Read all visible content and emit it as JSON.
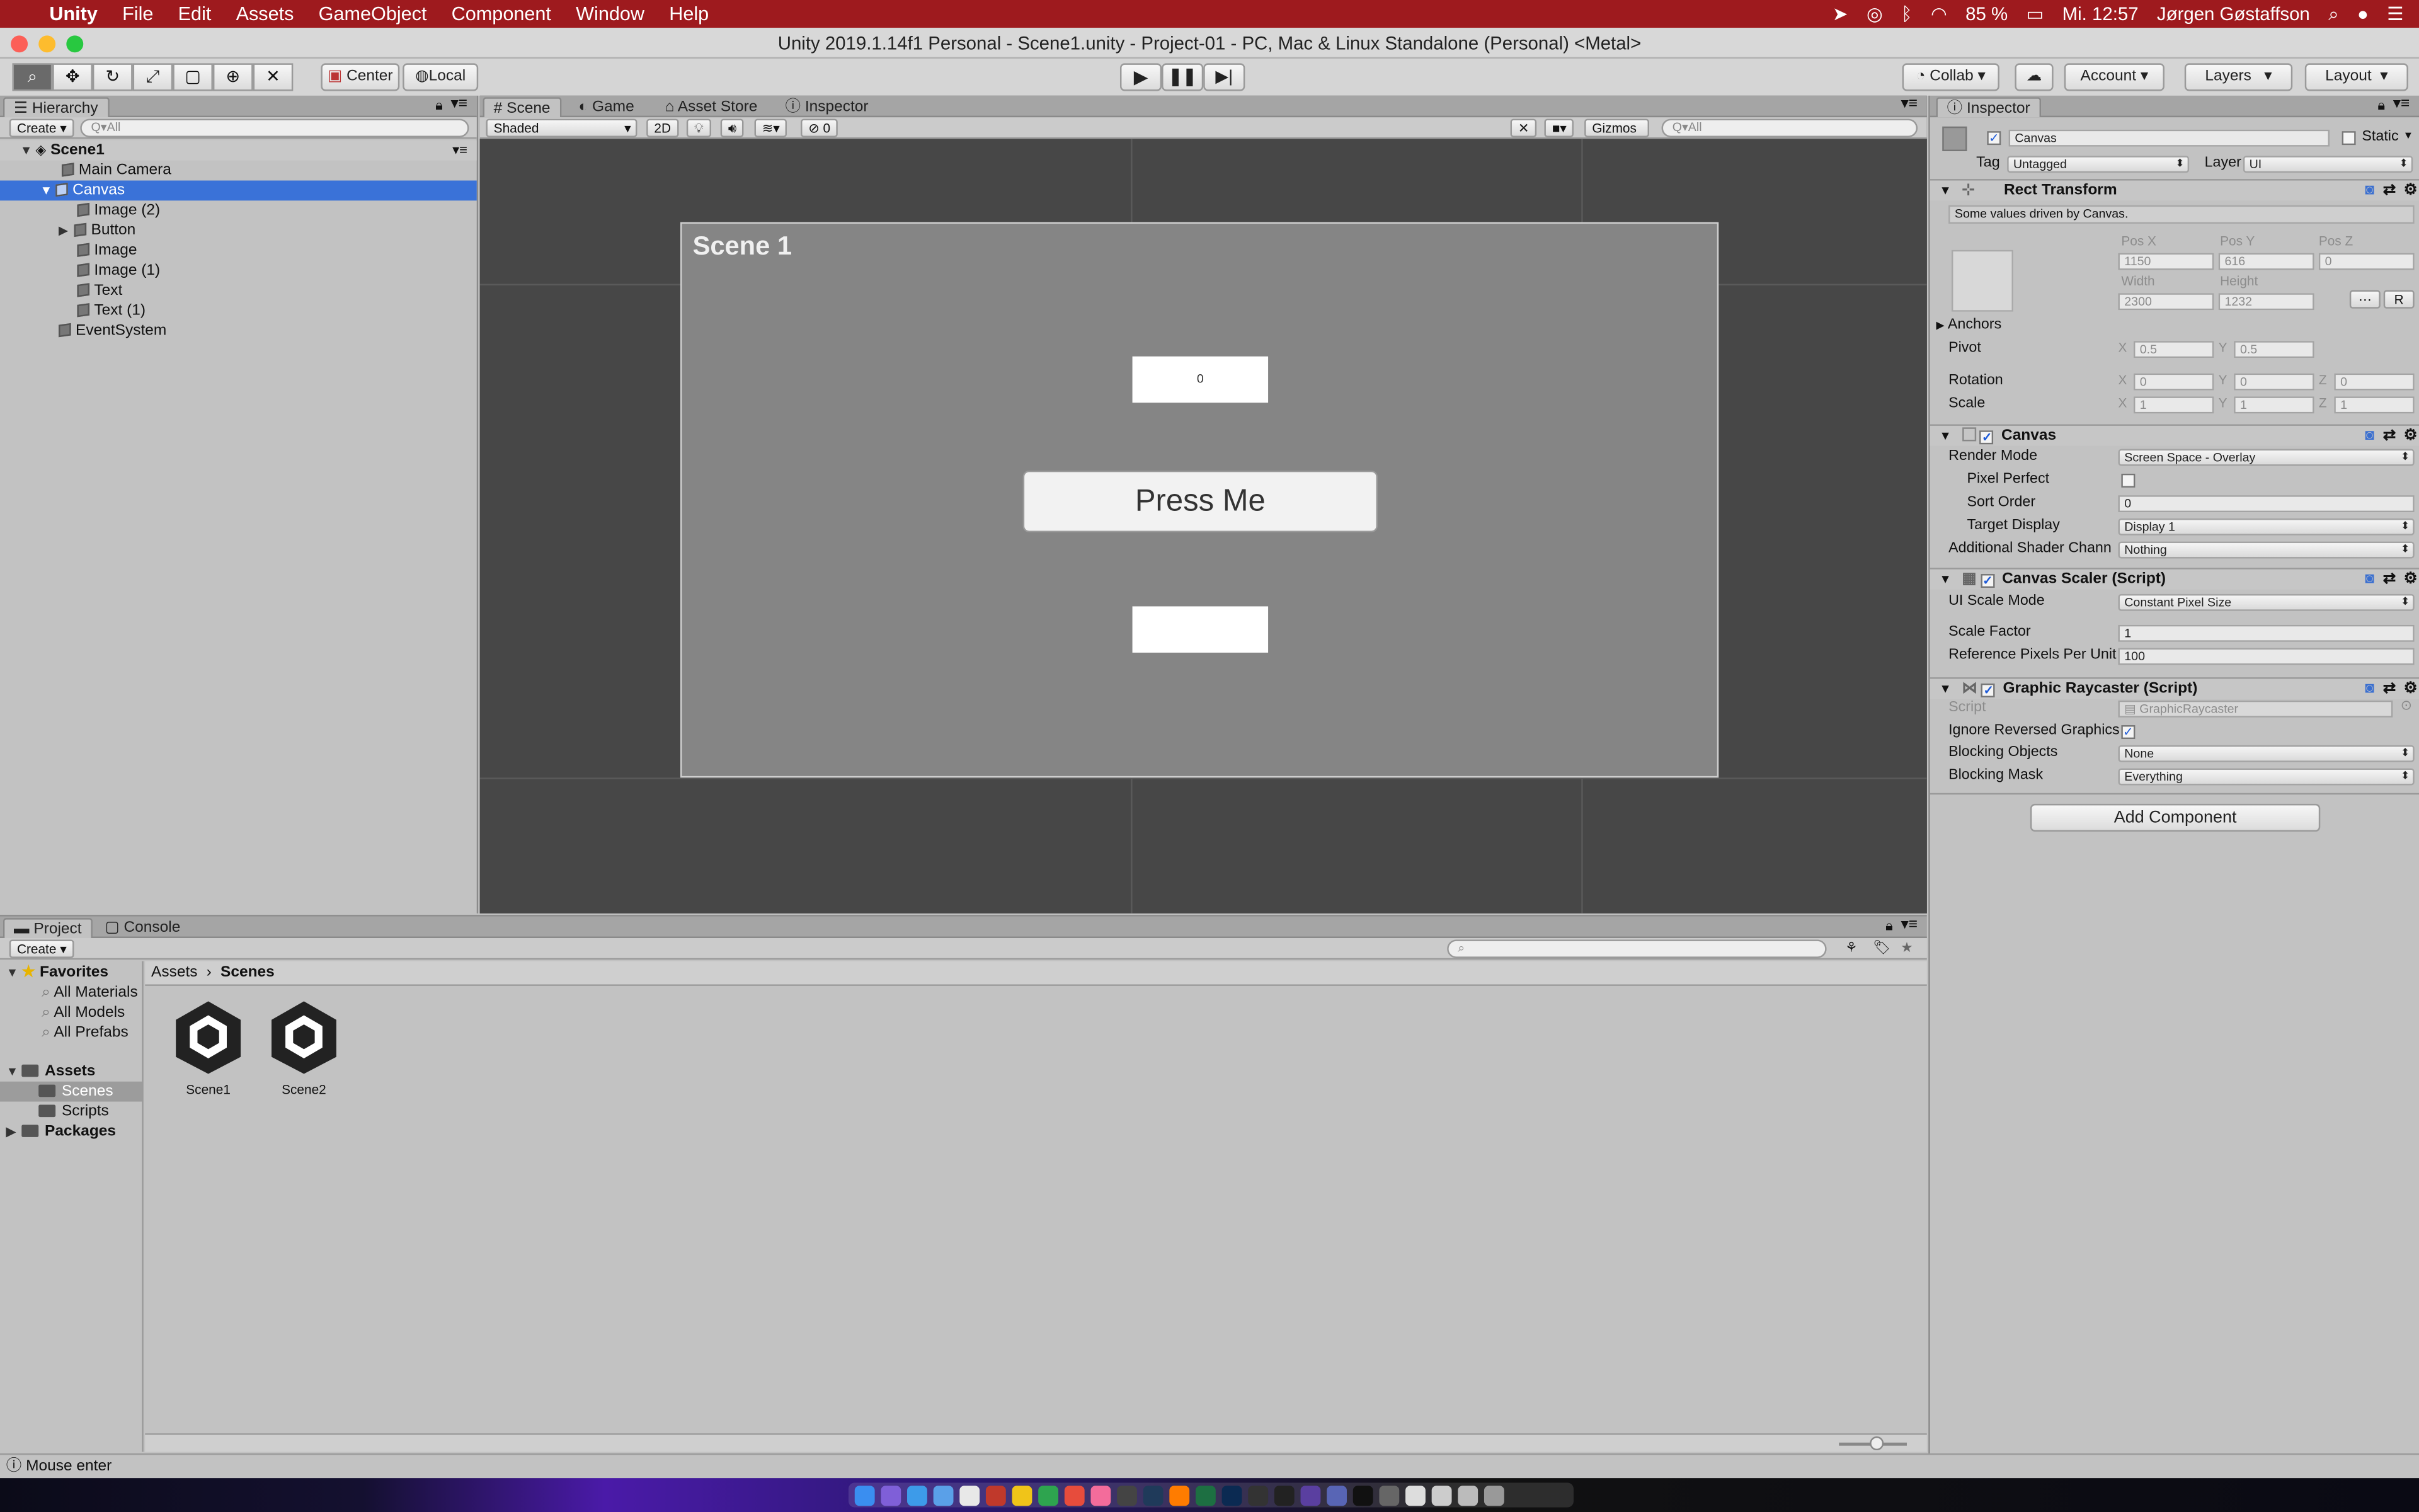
{
  "menubar": {
    "app": "Unity",
    "items": [
      "File",
      "Edit",
      "Assets",
      "GameObject",
      "Component",
      "Window",
      "Help"
    ],
    "battery": "85 %",
    "clock": "Mi. 12:57",
    "user": "Jørgen Gøstaffson"
  },
  "window": {
    "title": "Unity 2019.1.14f1 Personal - Scene1.unity - Project-01 - PC, Mac & Linux Standalone (Personal) <Metal>"
  },
  "toolbar": {
    "pivot": "Center",
    "space": "Local",
    "collab": "Collab",
    "account": "Account",
    "layers": "Layers",
    "layout": "Layout"
  },
  "hierarchy": {
    "tab": "Hierarchy",
    "create": "Create",
    "search_placeholder": "Q▾All",
    "scene": "Scene1",
    "items": [
      "Main Camera",
      "Canvas",
      "Image (2)",
      "Button",
      "Image",
      "Image (1)",
      "Text",
      "Text (1)",
      "EventSystem"
    ]
  },
  "scene_tabs": {
    "scene": "Scene",
    "game": "Game",
    "asset_store": "Asset Store",
    "inspector": "Inspector",
    "shading": "Shaded",
    "mode_2d": "2D",
    "hidden_count": "0",
    "gizmos": "Gizmos",
    "search_placeholder": "Q▾All"
  },
  "scene_content": {
    "title": "Scene 1",
    "counter": "0",
    "button_label": "Press Me"
  },
  "inspector": {
    "tab": "Inspector",
    "object_name": "Canvas",
    "static": "Static",
    "tag_label": "Tag",
    "tag": "Untagged",
    "layer_label": "Layer",
    "layer": "UI",
    "rect_transform": {
      "title": "Rect Transform",
      "note": "Some values driven by Canvas.",
      "pos_x_label": "Pos X",
      "pos_y_label": "Pos Y",
      "pos_z_label": "Pos Z",
      "pos_x": "1150",
      "pos_y": "616",
      "pos_z": "0",
      "width_label": "Width",
      "height_label": "Height",
      "width": "2300",
      "height": "1232",
      "r_button": "R",
      "anchors": "Anchors",
      "pivot": "Pivot",
      "pivot_x": "0.5",
      "pivot_y": "0.5",
      "rotation": "Rotation",
      "rot_x": "0",
      "rot_y": "0",
      "rot_z": "0",
      "scale": "Scale",
      "scale_x": "1",
      "scale_y": "1",
      "scale_z": "1",
      "x": "X",
      "y": "Y",
      "z": "Z"
    },
    "canvas": {
      "title": "Canvas",
      "render_mode_label": "Render Mode",
      "render_mode": "Screen Space - Overlay",
      "pixel_perfect_label": "Pixel Perfect",
      "sort_order_label": "Sort Order",
      "sort_order": "0",
      "target_display_label": "Target Display",
      "target_display": "Display 1",
      "shader_channels_label": "Additional Shader Chann",
      "shader_channels": "Nothing"
    },
    "canvas_scaler": {
      "title": "Canvas Scaler (Script)",
      "ui_scale_mode_label": "UI Scale Mode",
      "ui_scale_mode": "Constant Pixel Size",
      "scale_factor_label": "Scale Factor",
      "scale_factor": "1",
      "ref_ppu_label": "Reference Pixels Per Unit",
      "ref_ppu": "100"
    },
    "graphic_raycaster": {
      "title": "Graphic Raycaster (Script)",
      "script_label": "Script",
      "script": "GraphicRaycaster",
      "ignore_reversed_label": "Ignore Reversed Graphics",
      "blocking_objects_label": "Blocking Objects",
      "blocking_objects": "None",
      "blocking_mask_label": "Blocking Mask",
      "blocking_mask": "Everything"
    },
    "add_component": "Add Component"
  },
  "project": {
    "tab": "Project",
    "console_tab": "Console",
    "create": "Create",
    "favorites": "Favorites",
    "favorite_items": [
      "All Materials",
      "All Models",
      "All Prefabs"
    ],
    "assets": "Assets",
    "asset_folders": [
      "Scenes",
      "Scripts"
    ],
    "packages": "Packages",
    "breadcrumb": [
      "Assets",
      "Scenes"
    ],
    "files": [
      "Scene1",
      "Scene2"
    ]
  },
  "statusbar": {
    "message": "Mouse enter"
  },
  "colors": {
    "menubar": "#9e1a1e",
    "selection": "#3a72d8",
    "scene_bg": "#474747",
    "canvas_bg": "#858585"
  }
}
